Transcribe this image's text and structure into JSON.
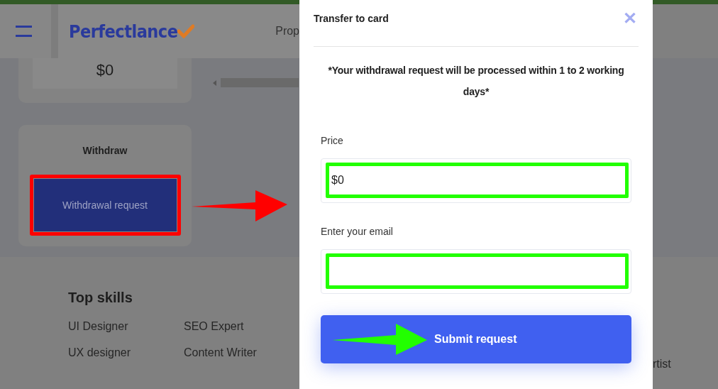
{
  "header": {
    "logo": "Perfectlance",
    "nav_cut": "Prop"
  },
  "balance_card": {
    "amount": "$0"
  },
  "withdraw_card": {
    "title": "Withdraw",
    "button": "Withdrawal request"
  },
  "footer": {
    "heading": "Top skills",
    "columns": [
      [
        "UI Designer",
        "UX designer"
      ],
      [
        "SEO Expert",
        "Content Writer"
      ]
    ],
    "right_cut": "rtist"
  },
  "modal": {
    "title": "Transfer to card",
    "close": "✕",
    "notice": "*Your withdrawal request will be processed within 1 to 2 working days*",
    "fields": [
      {
        "label": "Price",
        "value": "$0"
      },
      {
        "label": "Enter your email"
      }
    ],
    "submit": "Submit request"
  }
}
